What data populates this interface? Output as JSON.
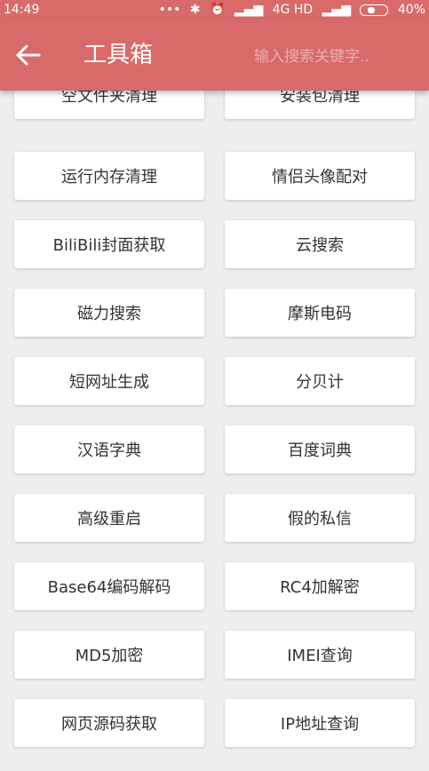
{
  "status_bar": {
    "time": "14:49",
    "network": "4G HD",
    "battery": "40%"
  },
  "app_bar": {
    "title": "工具箱",
    "search_placeholder": "输入搜索关键字..",
    "accent_color": "#d96a6a"
  },
  "tools": [
    [
      "空文件夹清理",
      "安装包清理"
    ],
    [
      "运行内存清理",
      "情侣头像配对"
    ],
    [
      "BiliBili封面获取",
      "云搜索"
    ],
    [
      "磁力搜索",
      "摩斯电码"
    ],
    [
      "短网址生成",
      "分贝计"
    ],
    [
      "汉语字典",
      "百度词典"
    ],
    [
      "高级重启",
      "假的私信"
    ],
    [
      "Base64编码解码",
      "RC4加解密"
    ],
    [
      "MD5加密",
      "IMEI查询"
    ],
    [
      "网页源码获取",
      "IP地址查询"
    ]
  ]
}
